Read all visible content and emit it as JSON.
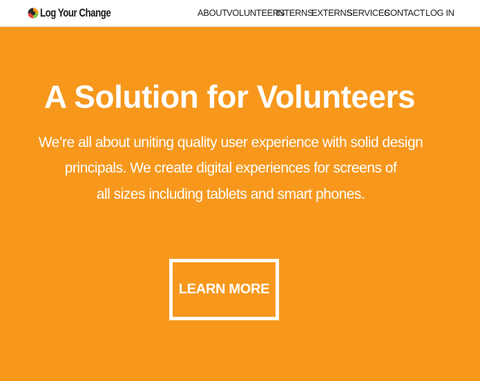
{
  "brand": {
    "name": "Log Your Change",
    "logo_icon": "swirl-globe-icon"
  },
  "nav": {
    "items": [
      "ABOUT",
      "VOLUNTEERS",
      "INTERNS",
      "EXTERNS",
      "SERVICES",
      "CONTACT"
    ],
    "login": "LOG IN"
  },
  "hero": {
    "title": "A Solution for Volunteers",
    "lines": [
      "We’re all about uniting quality user experience with solid design",
      "principals. We create digital experiences for screens of",
      "all sizes including tablets and smart phones."
    ],
    "cta_label": "LEARN MORE"
  },
  "colors": {
    "hero_background": "#f7981d",
    "navbar_background": "#ffffff",
    "text_on_hero": "#ffffff"
  }
}
